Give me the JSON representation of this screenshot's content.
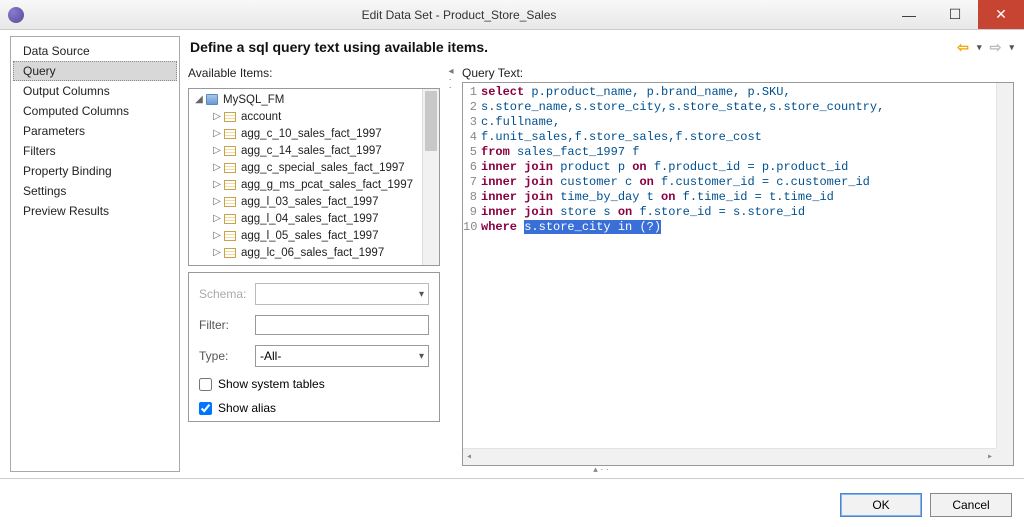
{
  "window": {
    "title": "Edit Data Set - Product_Store_Sales"
  },
  "sidebar": {
    "items": [
      {
        "label": "Data Source"
      },
      {
        "label": "Query"
      },
      {
        "label": "Output Columns"
      },
      {
        "label": "Computed Columns"
      },
      {
        "label": "Parameters"
      },
      {
        "label": "Filters"
      },
      {
        "label": "Property Binding"
      },
      {
        "label": "Settings"
      },
      {
        "label": "Preview Results"
      }
    ],
    "selected_index": 1
  },
  "header": {
    "title": "Define a sql query text using available items."
  },
  "available": {
    "label": "Available Items:",
    "root": "MySQL_FM",
    "tables": [
      "account",
      "agg_c_10_sales_fact_1997",
      "agg_c_14_sales_fact_1997",
      "agg_c_special_sales_fact_1997",
      "agg_g_ms_pcat_sales_fact_1997",
      "agg_l_03_sales_fact_1997",
      "agg_l_04_sales_fact_1997",
      "agg_l_05_sales_fact_1997",
      "agg_lc_06_sales_fact_1997"
    ]
  },
  "filters": {
    "schema_label": "Schema:",
    "filter_label": "Filter:",
    "filter_value": "",
    "type_label": "Type:",
    "type_value": "-All-",
    "show_system_label": "Show system tables",
    "show_system_checked": false,
    "show_alias_label": "Show alias",
    "show_alias_checked": true
  },
  "query": {
    "label": "Query Text:",
    "lines": [
      {
        "n": 1,
        "tokens": [
          {
            "t": "select ",
            "c": "kw"
          },
          {
            "t": "p.product_name, p.brand_name, p.SKU,",
            "c": "lit"
          }
        ]
      },
      {
        "n": 2,
        "tokens": [
          {
            "t": "s.store_name,s.store_city,s.store_state,s.store_country,",
            "c": "lit"
          }
        ]
      },
      {
        "n": 3,
        "tokens": [
          {
            "t": "c.fullname,",
            "c": "lit"
          }
        ]
      },
      {
        "n": 4,
        "tokens": [
          {
            "t": "f.unit_sales,f.store_sales,f.store_cost",
            "c": "lit"
          }
        ]
      },
      {
        "n": 5,
        "tokens": [
          {
            "t": "from ",
            "c": "kw"
          },
          {
            "t": "sales_fact_1997 f",
            "c": "lit"
          }
        ]
      },
      {
        "n": 6,
        "tokens": [
          {
            "t": "inner join ",
            "c": "kw"
          },
          {
            "t": "product p ",
            "c": "lit"
          },
          {
            "t": "on ",
            "c": "kw"
          },
          {
            "t": "f.product_id = p.product_id",
            "c": "lit"
          }
        ]
      },
      {
        "n": 7,
        "tokens": [
          {
            "t": "inner join ",
            "c": "kw"
          },
          {
            "t": "customer c ",
            "c": "lit"
          },
          {
            "t": "on ",
            "c": "kw"
          },
          {
            "t": "f.customer_id = c.customer_id",
            "c": "lit"
          }
        ]
      },
      {
        "n": 8,
        "tokens": [
          {
            "t": "inner join ",
            "c": "kw"
          },
          {
            "t": "time_by_day t ",
            "c": "lit"
          },
          {
            "t": "on ",
            "c": "kw"
          },
          {
            "t": "f.time_id = t.time_id",
            "c": "lit"
          }
        ]
      },
      {
        "n": 9,
        "tokens": [
          {
            "t": "inner join ",
            "c": "kw"
          },
          {
            "t": "store s ",
            "c": "lit"
          },
          {
            "t": "on ",
            "c": "kw"
          },
          {
            "t": "f.store_id = s.store_id",
            "c": "lit"
          }
        ]
      },
      {
        "n": 10,
        "tokens": [
          {
            "t": "where ",
            "c": "kw"
          },
          {
            "t": "s.store_city in (?)",
            "c": "sel"
          }
        ]
      }
    ]
  },
  "footer": {
    "ok_label": "OK",
    "cancel_label": "Cancel"
  }
}
